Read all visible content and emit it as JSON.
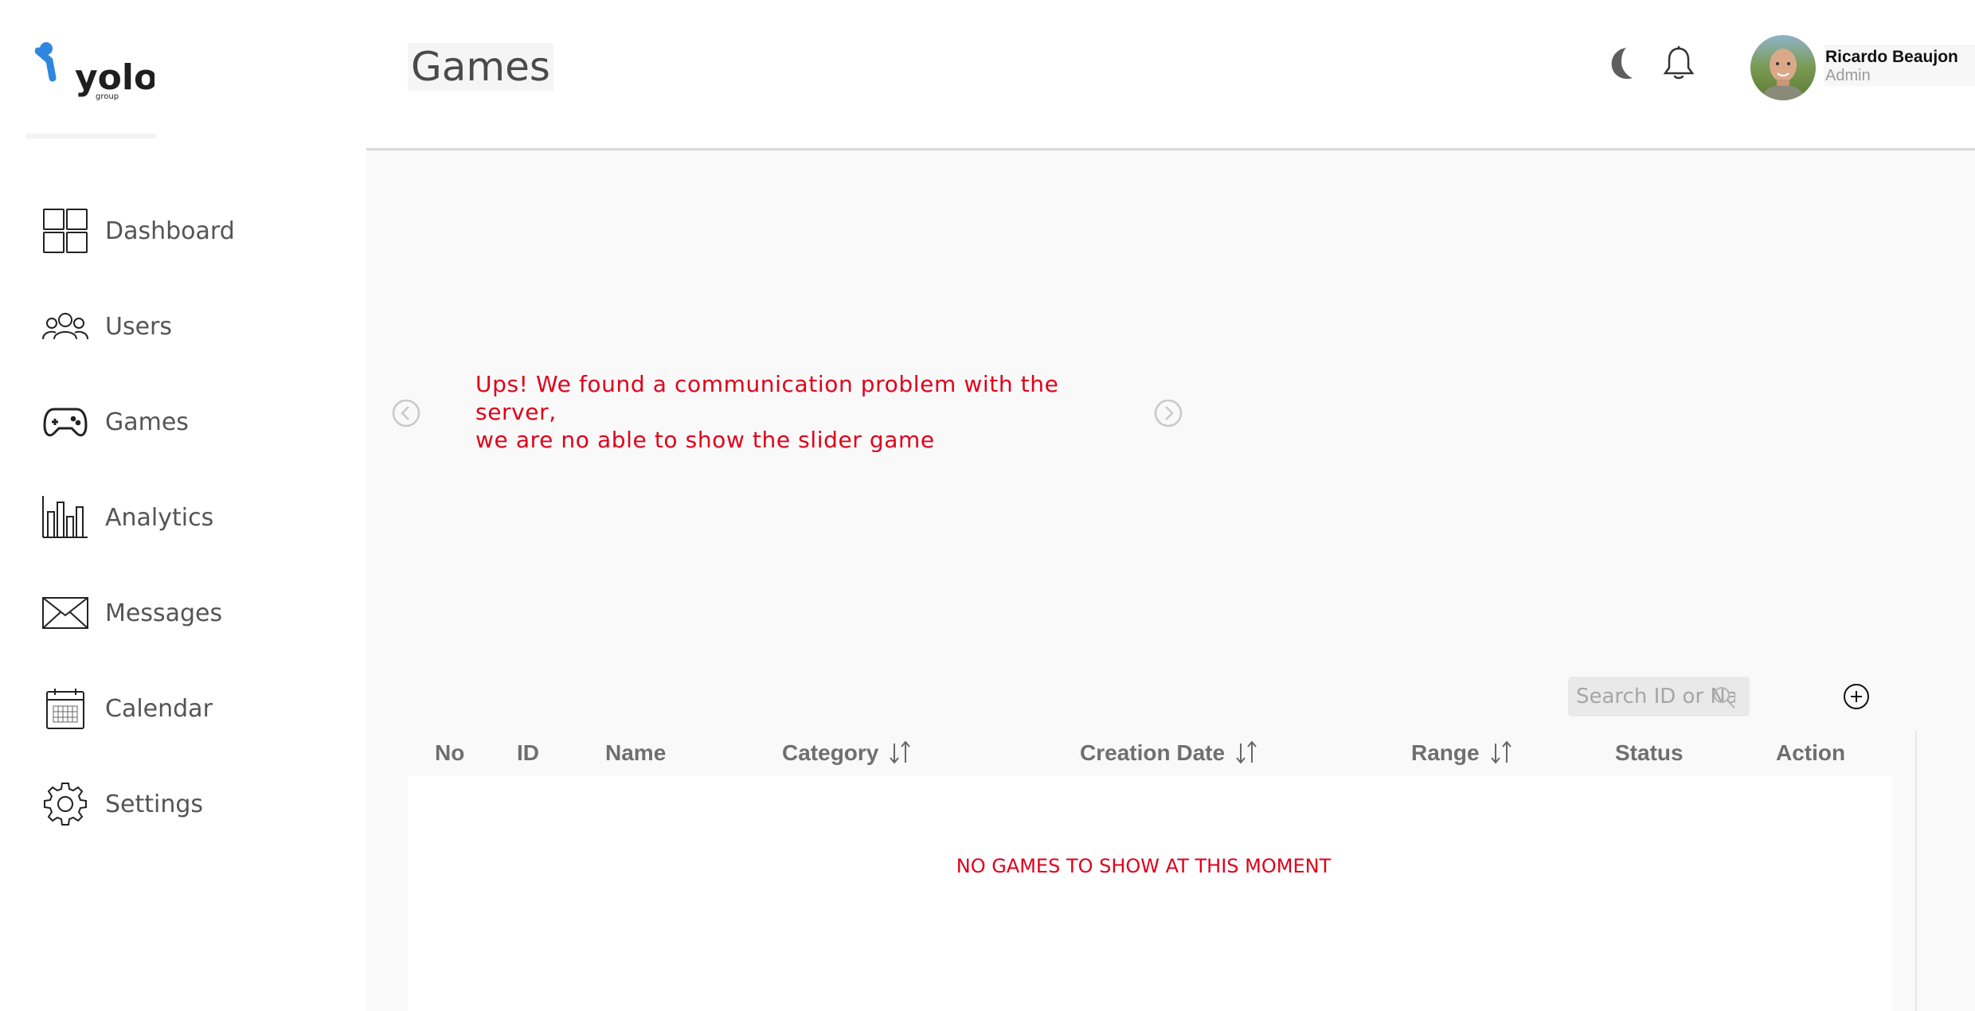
{
  "brand": {
    "logo_text": "yolo",
    "logo_subtext": "group",
    "accent_color": "#2e86de"
  },
  "sidebar": {
    "items": [
      {
        "label": "Dashboard",
        "icon": "dashboard-grid-icon"
      },
      {
        "label": "Users",
        "icon": "users-icon"
      },
      {
        "label": "Games",
        "icon": "gamepad-icon"
      },
      {
        "label": "Analytics",
        "icon": "bar-chart-icon"
      },
      {
        "label": "Messages",
        "icon": "envelope-icon"
      },
      {
        "label": "Calendar",
        "icon": "calendar-icon"
      },
      {
        "label": "Settings",
        "icon": "gear-icon"
      }
    ]
  },
  "header": {
    "title": "Games",
    "icons": [
      "moon-icon",
      "bell-icon"
    ],
    "user": {
      "name": "Ricardo Beaujon",
      "role": "Admin"
    }
  },
  "slider": {
    "error_line1": "Ups! We found a communication problem with the server,",
    "error_line2": "we are no able to show the slider game",
    "error_color": "#e0001b"
  },
  "table": {
    "search_placeholder": "Search ID or Name",
    "columns": [
      {
        "label": "No",
        "sortable": false
      },
      {
        "label": "ID",
        "sortable": false
      },
      {
        "label": "Name",
        "sortable": false
      },
      {
        "label": "Category",
        "sortable": true
      },
      {
        "label": "Creation Date",
        "sortable": true
      },
      {
        "label": "Range",
        "sortable": true
      },
      {
        "label": "Status",
        "sortable": false
      },
      {
        "label": "Action",
        "sortable": false
      }
    ],
    "rows": [],
    "empty_message": "NO GAMES TO SHOW AT THIS MOMENT"
  }
}
